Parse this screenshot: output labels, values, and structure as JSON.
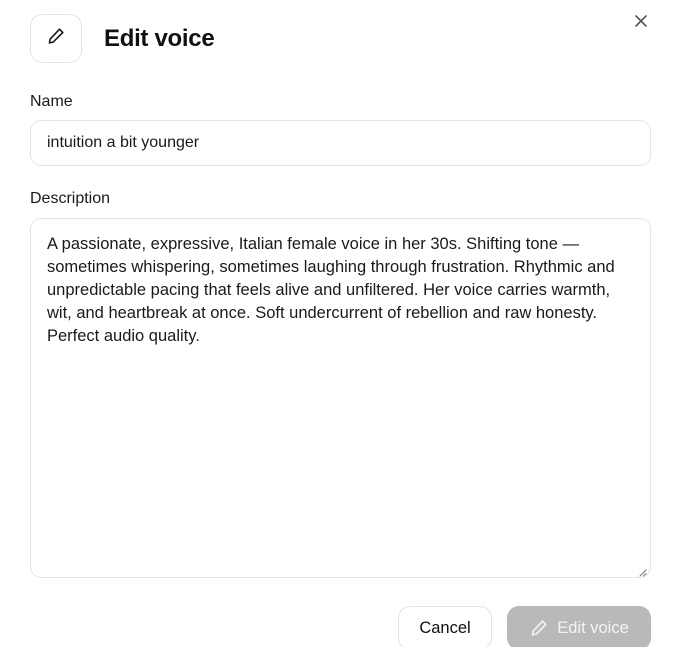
{
  "dialog": {
    "title": "Edit voice",
    "title_icon": "pencil-icon",
    "close_icon": "close-icon"
  },
  "form": {
    "name_label": "Name",
    "name_value": "intuition a bit younger",
    "description_label": "Description",
    "description_value": "A passionate, expressive, Italian female voice in her 30s. Shifting tone — sometimes whispering, sometimes laughing through frustration. Rhythmic and unpredictable pacing that feels alive and unfiltered. Her voice carries warmth, wit, and heartbreak at once. Soft undercurrent of rebellion and raw honesty. Perfect audio quality."
  },
  "actions": {
    "cancel_label": "Cancel",
    "submit_label": "Edit voice",
    "submit_icon": "pencil-icon",
    "submit_color": "#b9b9bb"
  }
}
